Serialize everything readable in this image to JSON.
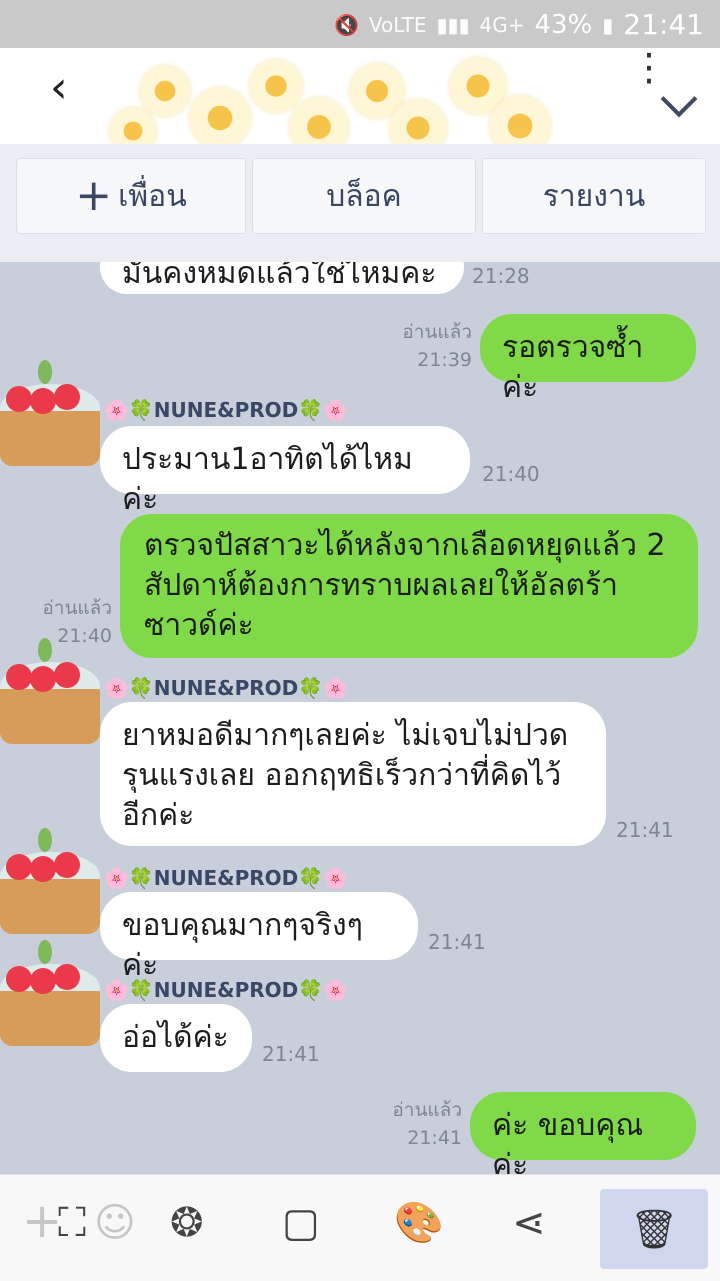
{
  "status_bar": {
    "time": "21:41",
    "battery": "43%",
    "network": "4G+",
    "volte": "VoLTE"
  },
  "header": {
    "back_icon": "chevron-left-icon",
    "more_icon": "more-vert-icon",
    "expand_icon": "chevron-down-icon"
  },
  "actions": {
    "add_friend": "เพื่อน",
    "block": "บล็อค",
    "report": "รายงาน"
  },
  "messages": [
    {
      "dir": "in",
      "text": "มันคงหมดแล้วใช่ไหมคะ",
      "time": "21:28"
    },
    {
      "dir": "out",
      "text": "รอตรวจซ้ำค่ะ",
      "read": "อ่านแล้ว",
      "time": "21:39"
    },
    {
      "dir": "in",
      "sender": "🌸🍀NUNE&PROD🍀🌸",
      "text": "ประมาน1อาทิตได้ไหมค่ะ",
      "time": "21:40"
    },
    {
      "dir": "out",
      "text": "ตรวจปัสสาวะได้หลังจากเลือดหยุดแล้ว 2 สัปดาห์ต้องการทราบผลเลยให้อัลตร้าซาวด์ค่ะ",
      "read": "อ่านแล้ว",
      "time": "21:40"
    },
    {
      "dir": "in",
      "sender": "🌸🍀NUNE&PROD🍀🌸",
      "text": "ยาหมอดีมากๆเลยค่ะ ไม่เจบไม่ปวดรุนแรงเลย ออกฤทธิเร็วกว่าที่คิดไว้อีกค่ะ",
      "time": "21:41"
    },
    {
      "dir": "in",
      "sender": "🌸🍀NUNE&PROD🍀🌸",
      "text": "ขอบคุณมากๆจริงๆค่ะ",
      "time": "21:41"
    },
    {
      "dir": "in",
      "sender": "🌸🍀NUNE&PROD🍀🌸",
      "text": "อ่อได้ค่ะ",
      "time": "21:41"
    },
    {
      "dir": "out",
      "text": "ค่ะ ขอบคุณค่ะ",
      "read": "อ่านแล้ว",
      "time": "21:41"
    }
  ],
  "toolbar": {
    "icons": [
      "add-icon",
      "crop-icon",
      "emoji-icon",
      "filter-icon",
      "sticker-text-icon",
      "paint-icon",
      "share-icon",
      "delete-icon"
    ]
  }
}
